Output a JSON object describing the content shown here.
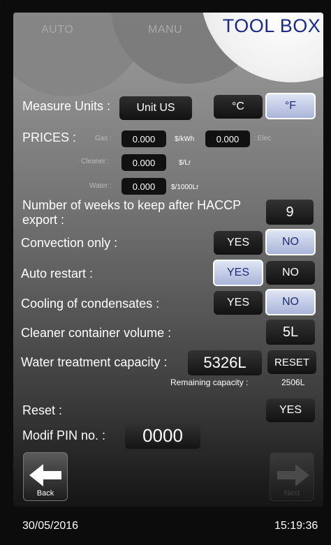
{
  "tabs": {
    "auto": "AUTO",
    "manu": "MANU",
    "toolbox": "TOOL BOX"
  },
  "measure_units": {
    "label": "Measure Units :",
    "unit_button": "Unit US",
    "celsius": "°C",
    "fahrenheit": "°F",
    "selected": "fahrenheit"
  },
  "prices": {
    "label": "PRICES :",
    "gas": {
      "label": "Gas :",
      "value": "0.000",
      "unit": "$/kWh"
    },
    "elec": {
      "label": ": Elec",
      "value": "0.000"
    },
    "cleaner": {
      "label": "Cleaner :",
      "value": "0.000",
      "unit": "$/Lr"
    },
    "water": {
      "label": "Water :",
      "value": "0.000",
      "unit": "$/1000Lr"
    }
  },
  "haccp": {
    "label_line1": "Number of weeks to keep after HACCP",
    "label_line2": "export :",
    "value": "9"
  },
  "convection_only": {
    "label": "Convection only :",
    "yes": "YES",
    "no": "NO",
    "selected": "no"
  },
  "auto_restart": {
    "label": "Auto restart :",
    "yes": "YES",
    "no": "NO",
    "selected": "yes"
  },
  "cooling_condensates": {
    "label": "Cooling of condensates :",
    "yes": "YES",
    "no": "NO",
    "selected": "no"
  },
  "cleaner_volume": {
    "label": "Cleaner container volume  :",
    "value": "5L"
  },
  "water_treatment": {
    "label": "Water treatment capacity :",
    "value": "5326L",
    "reset": "RESET",
    "remaining_label": "Remaining capacity :",
    "remaining_value": "2506L"
  },
  "reset": {
    "label": "Reset :",
    "yes": "YES"
  },
  "pin": {
    "label": "Modif PIN no. :",
    "value": "0000"
  },
  "nav": {
    "back": "Back",
    "next": "Next"
  },
  "status_bar": {
    "date": "30/05/2016",
    "time": "15:19:36"
  }
}
